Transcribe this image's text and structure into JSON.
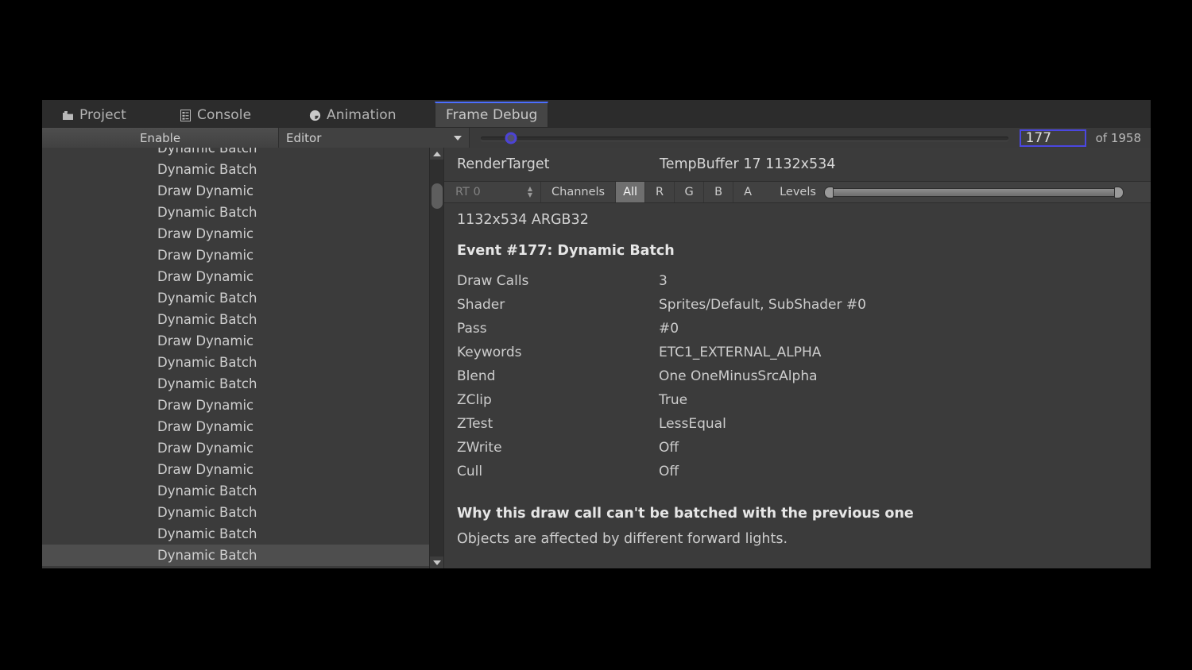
{
  "window": {
    "tabs": [
      {
        "label": "Project",
        "icon": "folder-icon",
        "active": false
      },
      {
        "label": "Console",
        "icon": "console-icon",
        "active": false
      },
      {
        "label": "Animation",
        "icon": "clock-icon",
        "active": false
      },
      {
        "label": "Frame Debug",
        "icon": "none",
        "active": true
      }
    ]
  },
  "toolbar": {
    "enable_label": "Enable",
    "target_dropdown": "Editor",
    "event_index": "177",
    "event_total": "of 1958"
  },
  "event_tree": {
    "rows": [
      {
        "label": "Dynamic Batch",
        "selected": false,
        "clipped": true
      },
      {
        "label": "Dynamic Batch",
        "selected": false
      },
      {
        "label": "Draw Dynamic",
        "selected": false
      },
      {
        "label": "Dynamic Batch",
        "selected": false
      },
      {
        "label": "Draw Dynamic",
        "selected": false
      },
      {
        "label": "Draw Dynamic",
        "selected": false
      },
      {
        "label": "Draw Dynamic",
        "selected": false
      },
      {
        "label": "Dynamic Batch",
        "selected": false
      },
      {
        "label": "Dynamic Batch",
        "selected": false
      },
      {
        "label": "Draw Dynamic",
        "selected": false
      },
      {
        "label": "Dynamic Batch",
        "selected": false
      },
      {
        "label": "Dynamic Batch",
        "selected": false
      },
      {
        "label": "Draw Dynamic",
        "selected": false
      },
      {
        "label": "Draw Dynamic",
        "selected": false
      },
      {
        "label": "Draw Dynamic",
        "selected": false
      },
      {
        "label": "Draw Dynamic",
        "selected": false
      },
      {
        "label": "Dynamic Batch",
        "selected": false
      },
      {
        "label": "Dynamic Batch",
        "selected": false
      },
      {
        "label": "Dynamic Batch",
        "selected": false
      },
      {
        "label": "Dynamic Batch",
        "selected": true
      }
    ]
  },
  "detail": {
    "rendertarget_label": "RenderTarget",
    "rendertarget_value": "TempBuffer 17 1132x534",
    "rt_select": "RT 0",
    "channels_label": "Channels",
    "channel_buttons": [
      {
        "label": "All",
        "selected": true
      },
      {
        "label": "R",
        "selected": false
      },
      {
        "label": "G",
        "selected": false
      },
      {
        "label": "B",
        "selected": false
      },
      {
        "label": "A",
        "selected": false
      }
    ],
    "levels_label": "Levels",
    "format_line": "1132x534 ARGB32",
    "event_title": "Event #177: Dynamic Batch",
    "properties": [
      {
        "key": "Draw Calls",
        "value": "3"
      },
      {
        "key": "Shader",
        "value": "Sprites/Default, SubShader #0"
      },
      {
        "key": "Pass",
        "value": "#0"
      },
      {
        "key": "Keywords",
        "value": "ETC1_EXTERNAL_ALPHA"
      },
      {
        "key": "Blend",
        "value": "One OneMinusSrcAlpha"
      },
      {
        "key": "ZClip",
        "value": "True"
      },
      {
        "key": "ZTest",
        "value": "LessEqual"
      },
      {
        "key": "ZWrite",
        "value": "Off"
      },
      {
        "key": "Cull",
        "value": "Off"
      }
    ],
    "why_title": "Why this draw call can't be batched with the previous one",
    "why_body": "Objects are affected by different forward lights."
  },
  "colors": {
    "accent_blue": "#4b47e0",
    "tab_active_border": "#4b6eff",
    "panel_bg": "#3b3b3b",
    "toolbar_bg": "#3a3a3a",
    "selection": "#4e4e4e"
  }
}
